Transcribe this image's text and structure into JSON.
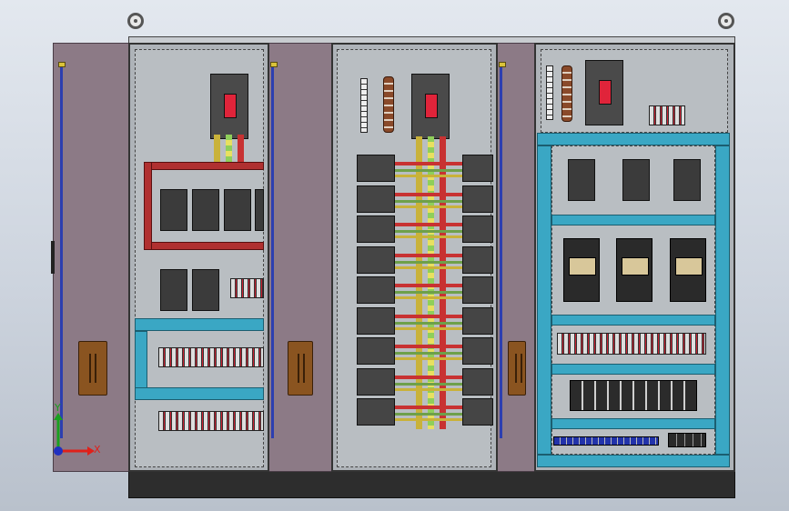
{
  "viewport": {
    "background": "#d5dbe3"
  },
  "axes": {
    "x_label": "X",
    "y_label": "Y",
    "x_color": "#e0201a",
    "y_color": "#1aa020",
    "origin_color": "#2030c0"
  },
  "colors": {
    "door": "#8c7a86",
    "rail": "#3aa7c4",
    "busbar": "#b03030",
    "breaker": "#4a4a4a",
    "plinth": "#2d2d2d"
  },
  "cabinets": [
    {
      "name": "left-cabinet",
      "components": [
        "main-breaker",
        "busbar-frame",
        "mcb-row",
        "terminal-strips"
      ]
    },
    {
      "name": "center-cabinet",
      "components": [
        "main-breaker",
        "busbar-stack",
        "mcb-grid"
      ]
    },
    {
      "name": "right-cabinet",
      "components": [
        "main-breaker",
        "mcb-row",
        "contactors",
        "terminal-strips",
        "relays"
      ]
    }
  ]
}
